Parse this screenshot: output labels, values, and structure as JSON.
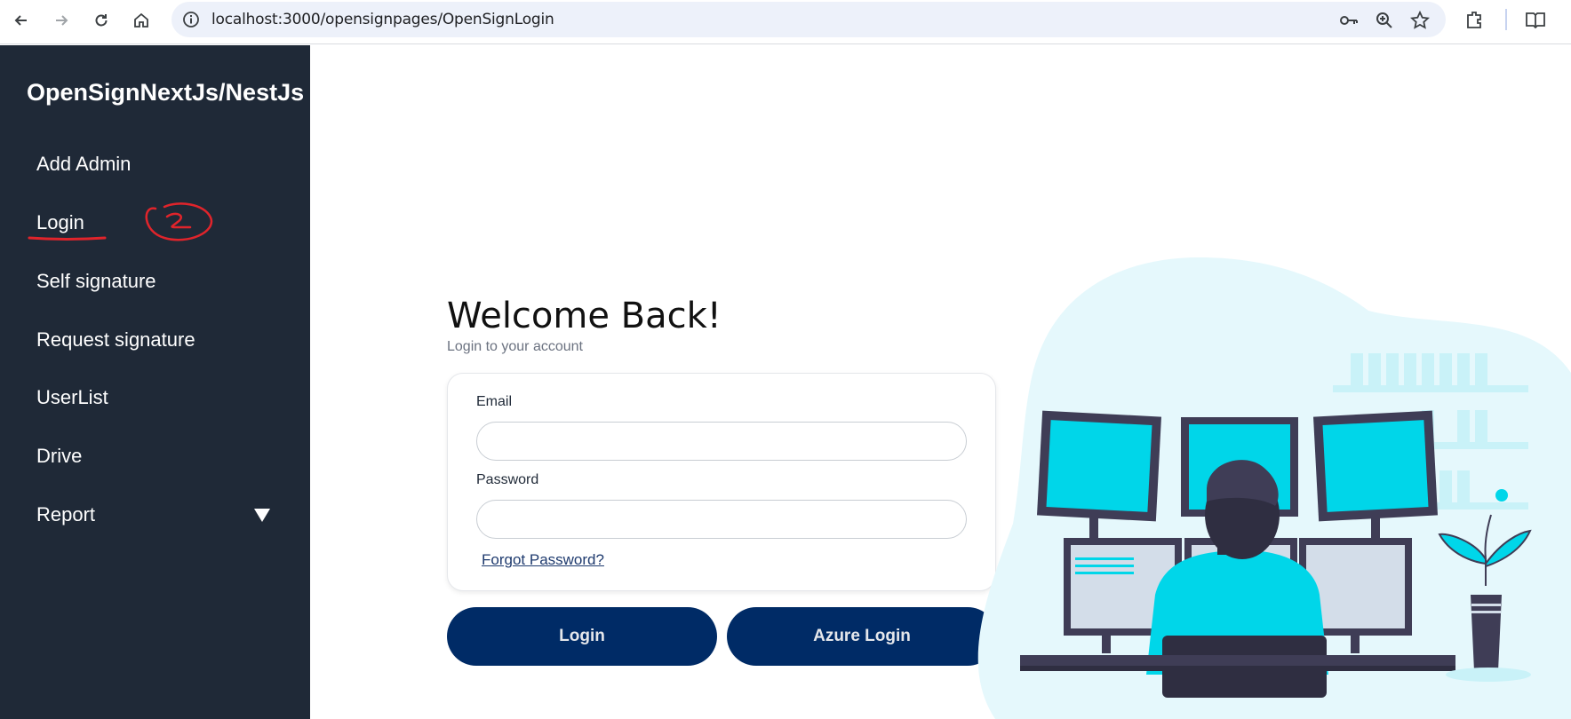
{
  "browser": {
    "url": "localhost:3000/opensignpages/OpenSignLogin"
  },
  "sidebar": {
    "brand": "OpenSignNextJs/NestJs",
    "items": [
      {
        "label": "Add Admin"
      },
      {
        "label": "Login"
      },
      {
        "label": "Self signature"
      },
      {
        "label": "Request signature"
      },
      {
        "label": "UserList"
      },
      {
        "label": "Drive"
      },
      {
        "label": "Report"
      }
    ],
    "annotation_color": "#e0242b"
  },
  "main": {
    "title": "Welcome Back!",
    "subtitle": "Login to your account",
    "email_label": "Email",
    "email_value": "",
    "password_label": "Password",
    "password_value": "",
    "forgot_label": "Forgot Password?",
    "login_button": "Login",
    "azure_button": "Azure Login"
  },
  "colors": {
    "sidebar_bg": "#1f2937",
    "button_bg": "#002b66",
    "accent_cyan": "#00d6e9"
  }
}
